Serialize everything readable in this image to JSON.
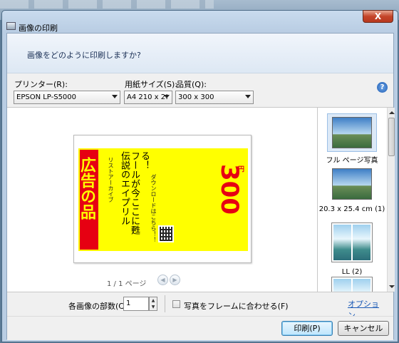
{
  "window": {
    "title": "画像の印刷",
    "close_label": "X"
  },
  "header": {
    "prompt": "画像をどのように印刷しますか?"
  },
  "settings": {
    "printer_label": "プリンター(R):",
    "printer_value": "EPSON LP-S5000",
    "paper_label": "用紙サイズ(S):",
    "paper_value": "A4 210 x 2!",
    "quality_label": "品質(Q):",
    "quality_value": "300 x 300",
    "help_label": "?"
  },
  "preview": {
    "flyer": {
      "badge": "広告の品",
      "category": "リストアーカイブ",
      "line1": "伝説のエイプリル",
      "line2": "フールが今ここに甦",
      "line3": "る！",
      "download": "ダウンロードはこちら！！",
      "price": "300",
      "currency": "円"
    },
    "pager": "1 / 1 ページ",
    "prev_icon": "◀",
    "next_icon": "▶"
  },
  "layouts": [
    {
      "label": "フル ページ写真",
      "selected": true
    },
    {
      "label": "20.3 x 25.4 cm (1)",
      "selected": false
    },
    {
      "label": "LL (2)",
      "selected": false
    },
    {
      "label": "",
      "selected": false
    }
  ],
  "footer": {
    "copies_label": "各画像の部数(C):",
    "copies_value": "1",
    "fit_label": "写真をフレームに合わせる(F)",
    "options_link": "オプション...",
    "print_button": "印刷(P)",
    "cancel_button": "キャンセル"
  },
  "colors": {
    "accent": "#e60012",
    "flyer_bg": "#ffff00",
    "link": "#1b5ab6"
  }
}
